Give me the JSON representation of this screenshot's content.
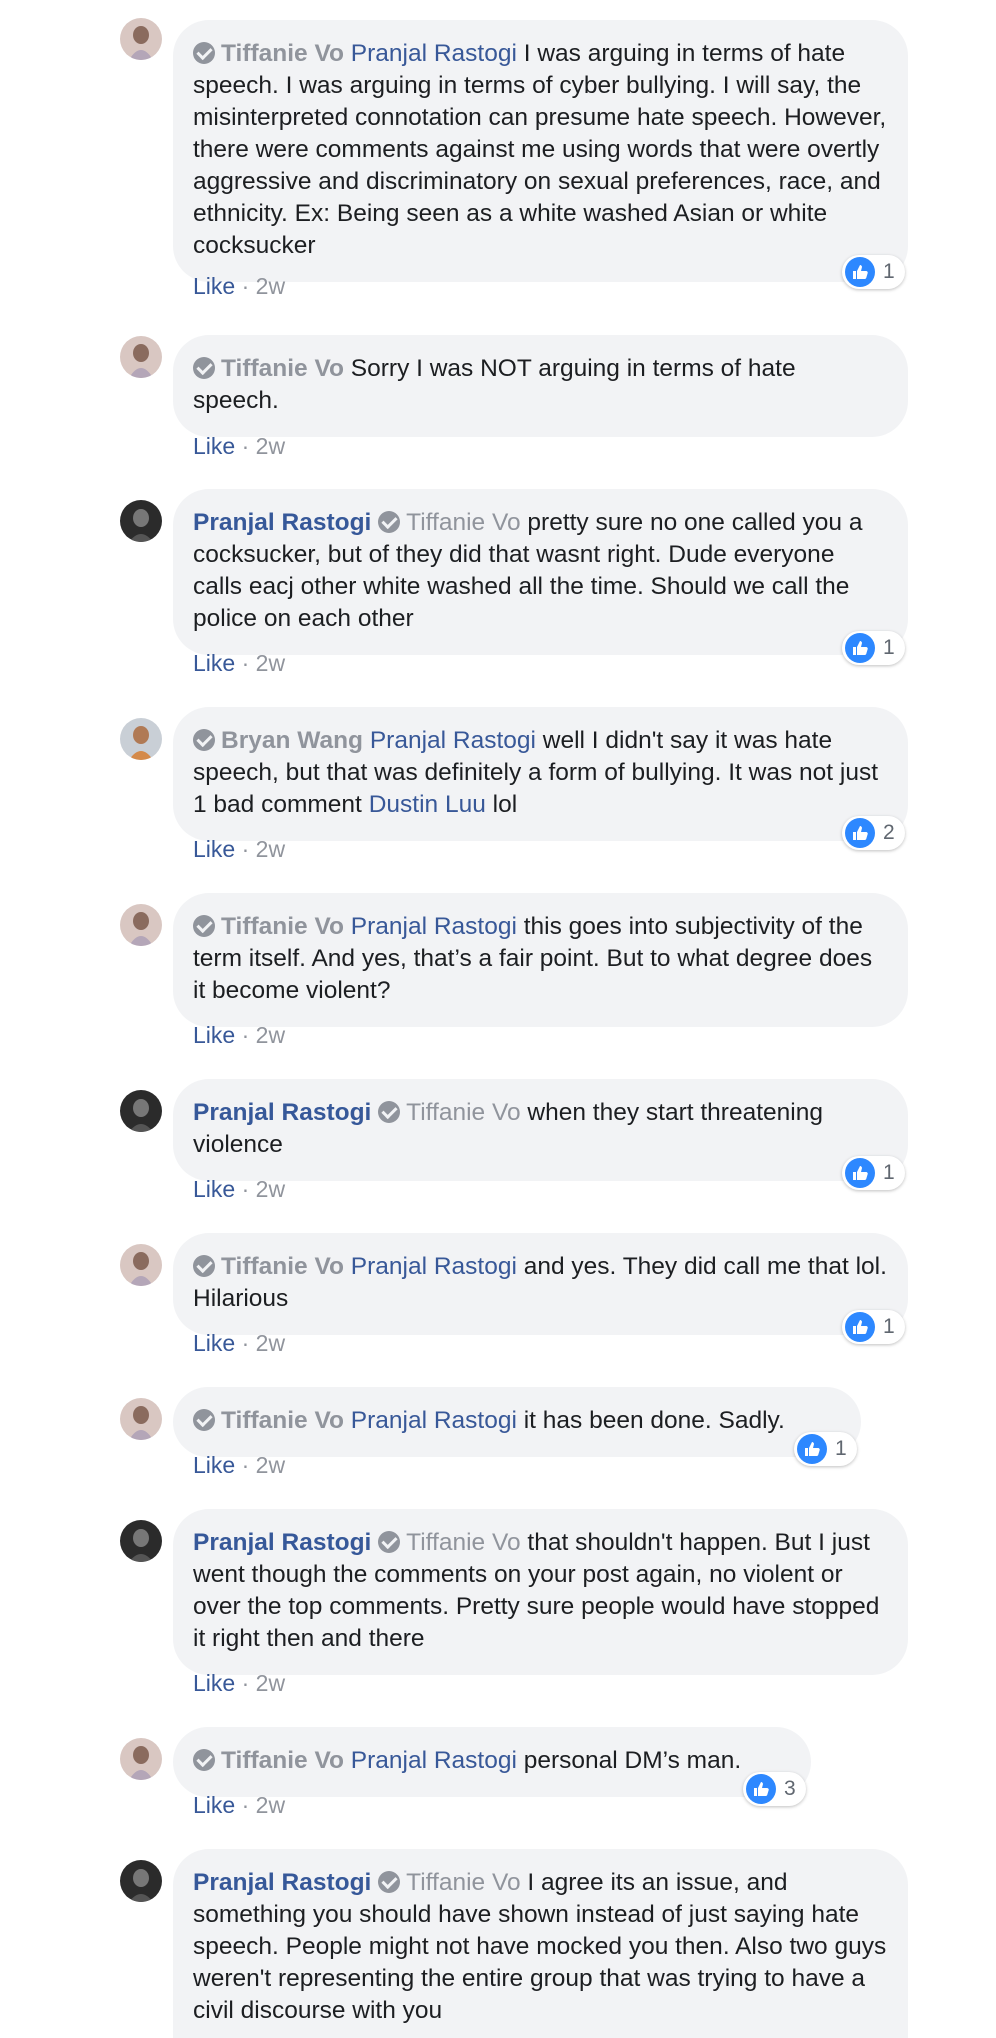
{
  "comments": [
    {
      "author": "Tiffanie Vo",
      "mention": "Pranjal Rastogi",
      "text": "I was arguing in terms of hate speech. I was arguing in terms of cyber bullying. I will say, the misinterpreted connotation can presume hate speech. However, there were comments against me using words that were overtly aggressive and discriminatory on sexual preferences, race, and ethnicity. Ex: Being seen as a white washed Asian or white cocksucker",
      "like_label": "Like",
      "time": "2w",
      "reactions": "1"
    },
    {
      "author": "Tiffanie Vo",
      "mention": "",
      "text": "Sorry I was NOT arguing in terms of hate speech.",
      "like_label": "Like",
      "time": "2w",
      "reactions": ""
    },
    {
      "author": "Pranjal Rastogi",
      "mention": "Tiffanie Vo",
      "text": "pretty sure no one called you a cocksucker, but of they did that wasnt right. Dude everyone calls eacj other white washed all the time. Should we call the police on each other",
      "like_label": "Like",
      "time": "2w",
      "reactions": "1"
    },
    {
      "author": "Bryan Wang",
      "mention": "Pranjal Rastogi",
      "text_before": "well I didn't say it was hate speech, but that was definitely a form of bullying. It was not just 1 bad comment",
      "inline_mention": "Dustin Luu",
      "text_after": "lol",
      "like_label": "Like",
      "time": "2w",
      "reactions": "2"
    },
    {
      "author": "Tiffanie Vo",
      "mention": "Pranjal Rastogi",
      "text": "this goes into subjectivity of the term itself. And yes, that’s a fair point. But to what degree does it become violent?",
      "like_label": "Like",
      "time": "2w",
      "reactions": ""
    },
    {
      "author": "Pranjal Rastogi",
      "mention": "Tiffanie Vo",
      "text": "when they start threatening violence",
      "like_label": "Like",
      "time": "2w",
      "reactions": "1"
    },
    {
      "author": "Tiffanie Vo",
      "mention": "Pranjal Rastogi",
      "text": "and yes. They did call me that lol. Hilarious",
      "like_label": "Like",
      "time": "2w",
      "reactions": "1"
    },
    {
      "author": "Tiffanie Vo",
      "mention": "Pranjal Rastogi",
      "text": "it has been done. Sadly.",
      "like_label": "Like",
      "time": "2w",
      "reactions": "1"
    },
    {
      "author": "Pranjal Rastogi",
      "mention": "Tiffanie Vo",
      "text": "that shouldn't happen. But I just went though the comments on your post again, no violent or over the top comments. Pretty sure people would have stopped it right then and there",
      "like_label": "Like",
      "time": "2w",
      "reactions": ""
    },
    {
      "author": "Tiffanie Vo",
      "mention": "Pranjal Rastogi",
      "text": "personal DM’s man.",
      "like_label": "Like",
      "time": "2w",
      "reactions": "3"
    },
    {
      "author": "Pranjal Rastogi",
      "mention": "Tiffanie Vo",
      "text": "I agree its an issue, and something you should have shown instead of just saying hate speech. People might not have mocked you then. Also two guys weren't representing the entire group that was trying to have a civil discourse with you"
    }
  ],
  "separator": " · ",
  "colors": {
    "bubble": "#f2f3f5",
    "link": "#385898",
    "muted": "#90949c",
    "reaction_blue": "#2d88ff"
  }
}
